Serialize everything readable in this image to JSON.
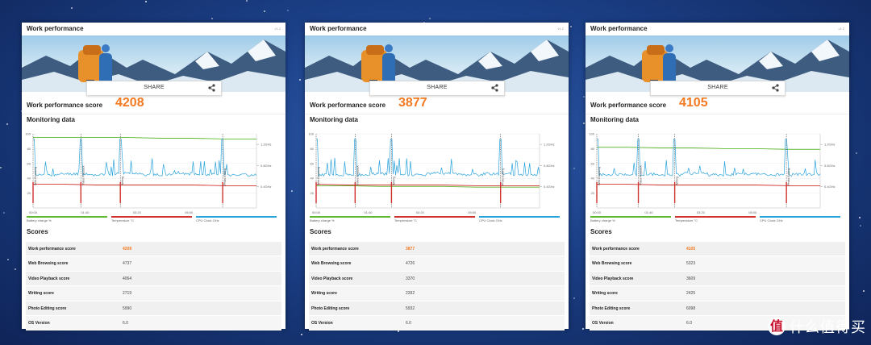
{
  "panels": [
    {
      "title": "Work performance",
      "version": "v1.2",
      "share_label": "SHARE",
      "score_label": "Work performance score",
      "score": "4208",
      "monitoring_title": "Monitoring data",
      "scores_title": "Scores",
      "chart_data": {
        "type": "line",
        "x_ticks": [
          "00:00",
          "01:40",
          "03:20",
          "05:00"
        ],
        "y_ticks_left": [
          "100",
          "80",
          "60",
          "40",
          "20"
        ],
        "y_ticks_right": [
          "1.2GHz",
          "0.8GHz",
          "0.4GHz"
        ],
        "xlim_minutes": [
          0,
          430
        ],
        "markers": [
          {
            "label": "Web Browsing",
            "x": 0
          },
          {
            "label": "Video Playback",
            "x": 92
          },
          {
            "label": "Writing",
            "x": 168
          },
          {
            "label": "Photo Editing",
            "x": 365
          }
        ],
        "series": [
          {
            "name": "Battery charge %",
            "color": "#5cb82e",
            "values": [
              95,
              95,
              95,
              95,
              94,
              94,
              93,
              93
            ]
          },
          {
            "name": "Temperature °C",
            "color": "#d0312d",
            "values": [
              32,
              32,
              31,
              31,
              31,
              31,
              30,
              30
            ]
          },
          {
            "name": "CPU Clock GHz",
            "color": "#29a3dc",
            "values": [
              0.6,
              0.62,
              0.6,
              0.63,
              0.6,
              0.62,
              0.61,
              0.6
            ]
          }
        ]
      },
      "rows": [
        {
          "label": "Work performance score",
          "value": "4208"
        },
        {
          "label": "Web Browsing score",
          "value": "4737"
        },
        {
          "label": "Video Playback score",
          "value": "4064"
        },
        {
          "label": "Writing score",
          "value": "2719"
        },
        {
          "label": "Photo Editing score",
          "value": "5990"
        },
        {
          "label": "OS Version",
          "value": "6.0"
        }
      ]
    },
    {
      "title": "Work performance",
      "version": "v1.2",
      "share_label": "SHARE",
      "score_label": "Work performance score",
      "score": "3877",
      "monitoring_title": "Monitoring data",
      "scores_title": "Scores",
      "chart_data": {
        "type": "line",
        "x_ticks": [
          "00:00",
          "01:40",
          "03:20",
          "05:00"
        ],
        "y_ticks_left": [
          "100",
          "80",
          "60",
          "40",
          "20"
        ],
        "y_ticks_right": [
          "1.2GHz",
          "0.8GHz",
          "0.4GHz"
        ],
        "xlim_minutes": [
          0,
          430
        ],
        "markers": [
          {
            "label": "Web Browsing",
            "x": 0
          },
          {
            "label": "Video Playback",
            "x": 75
          },
          {
            "label": "Writing",
            "x": 145
          },
          {
            "label": "Photo Editing",
            "x": 355
          }
        ],
        "series": [
          {
            "name": "Battery charge %",
            "color": "#5cb82e",
            "values": [
              30,
              30,
              29,
              29,
              29,
              28,
              28,
              28
            ]
          },
          {
            "name": "Temperature °C",
            "color": "#d0312d",
            "values": [
              32,
              31,
              31,
              31,
              31,
              30,
              30,
              30
            ]
          },
          {
            "name": "CPU Clock GHz",
            "color": "#29a3dc",
            "values": [
              0.6,
              0.6,
              0.62,
              0.6,
              0.63,
              0.6,
              0.62,
              0.6
            ]
          }
        ]
      },
      "rows": [
        {
          "label": "Work performance score",
          "value": "3877"
        },
        {
          "label": "Web Browsing score",
          "value": "4726"
        },
        {
          "label": "Video Playback score",
          "value": "3370"
        },
        {
          "label": "Writing score",
          "value": "2392"
        },
        {
          "label": "Photo Editing score",
          "value": "5932"
        },
        {
          "label": "OS Version",
          "value": "6.0"
        }
      ]
    },
    {
      "title": "Work performance",
      "version": "v1.2",
      "share_label": "SHARE",
      "score_label": "Work performance score",
      "score": "4105",
      "monitoring_title": "Monitoring data",
      "scores_title": "Scores",
      "chart_data": {
        "type": "line",
        "x_ticks": [
          "00:00",
          "01:40",
          "03:20",
          "05:00"
        ],
        "y_ticks_left": [
          "100",
          "80",
          "60",
          "40",
          "20"
        ],
        "y_ticks_right": [
          "1.2GHz",
          "0.8GHz",
          "0.4GHz"
        ],
        "xlim_minutes": [
          0,
          430
        ],
        "markers": [
          {
            "label": "Web Browsing",
            "x": 0
          },
          {
            "label": "Video Playback",
            "x": 80
          },
          {
            "label": "Writing",
            "x": 150
          },
          {
            "label": "Photo Editing",
            "x": 365
          }
        ],
        "series": [
          {
            "name": "Battery charge %",
            "color": "#5cb82e",
            "values": [
              82,
              82,
              81,
              81,
              80,
              80,
              79,
              79
            ]
          },
          {
            "name": "Temperature °C",
            "color": "#d0312d",
            "values": [
              32,
              32,
              31,
              31,
              31,
              31,
              30,
              30
            ]
          },
          {
            "name": "CPU Clock GHz",
            "color": "#29a3dc",
            "values": [
              0.6,
              0.61,
              0.6,
              0.63,
              0.6,
              0.62,
              0.6,
              0.61
            ]
          }
        ]
      },
      "rows": [
        {
          "label": "Work performance score",
          "value": "4105"
        },
        {
          "label": "Web Browsing score",
          "value": "5323"
        },
        {
          "label": "Video Playback score",
          "value": "3609"
        },
        {
          "label": "Writing score",
          "value": "2425"
        },
        {
          "label": "Photo Editing score",
          "value": "6098"
        },
        {
          "label": "OS Version",
          "value": "6.0"
        }
      ]
    }
  ],
  "watermark": {
    "badge": "值",
    "text": "什么值得买"
  },
  "icons": {
    "share": "share-icon"
  },
  "colors": {
    "accent": "#f47920",
    "background": "#1b3f86"
  }
}
